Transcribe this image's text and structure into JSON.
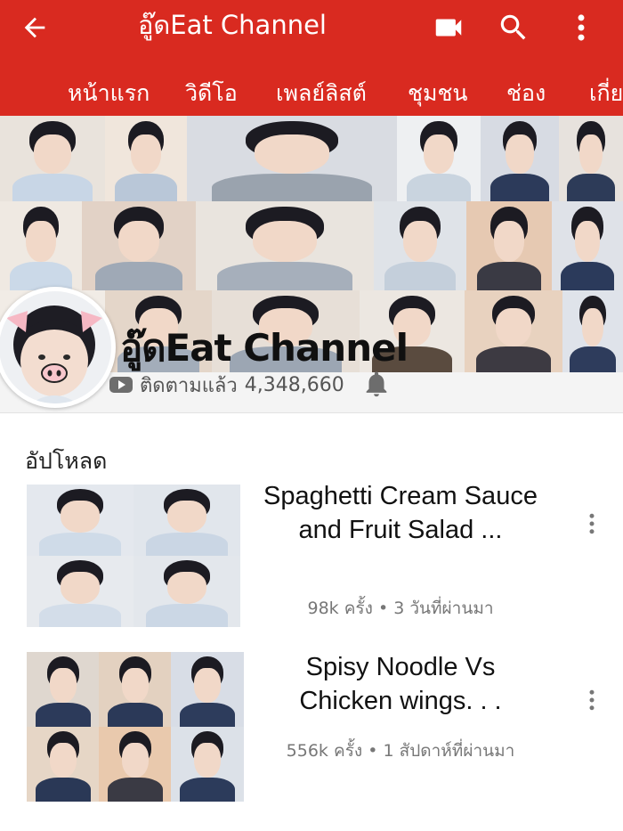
{
  "header": {
    "title": "อู๊ดEat Channel",
    "color": "#d92a20",
    "back_icon": "arrow-left",
    "video_icon": "videocam",
    "search_icon": "search",
    "more_icon": "more-vertical"
  },
  "tabs": [
    {
      "label": "หน้าแรก"
    },
    {
      "label": "วิดีโอ"
    },
    {
      "label": "เพลย์ลิสต์"
    },
    {
      "label": "ชุมชน"
    },
    {
      "label": "ช่อง"
    },
    {
      "label": "เกี่ย"
    }
  ],
  "channel": {
    "name": "อู๊ดEat Channel",
    "subscribed_label": "ติดตามแล้ว",
    "subscriber_count": "4,348,660"
  },
  "uploads": {
    "section_title": "อัปโหลด",
    "videos": [
      {
        "title": "Spaghetti Cream Sauce and Fruit Salad ...",
        "views": "98k ครั้ง",
        "age": "3 วันที่ผ่านมา",
        "separator": "•"
      },
      {
        "title": "Spisy Noodle Vs Chicken wings. . .",
        "views": "556k ครั้ง",
        "age": "1 สัปดาห์ที่ผ่านมา",
        "separator": "•"
      }
    ]
  }
}
